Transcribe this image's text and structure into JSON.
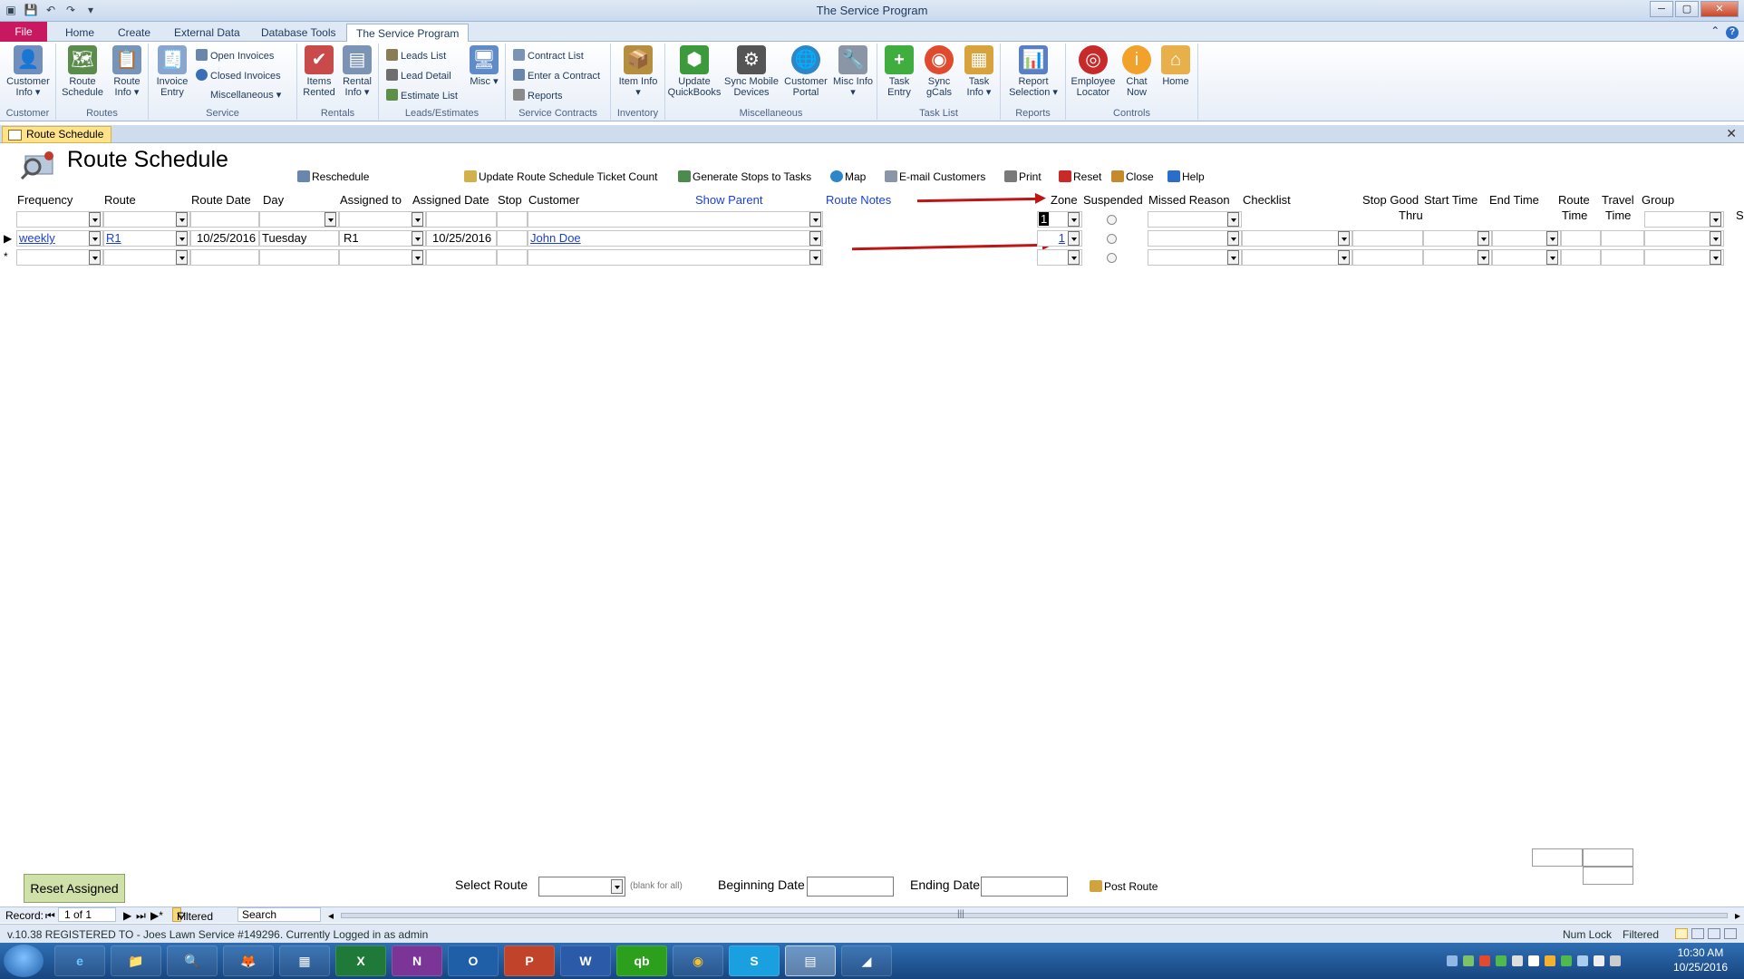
{
  "window": {
    "title": "The Service Program"
  },
  "tabs": [
    "File",
    "Home",
    "Create",
    "External Data",
    "Database Tools",
    "The Service Program"
  ],
  "ribbon": {
    "groups": {
      "customer": "Customer",
      "routes": "Routes",
      "service": "Service",
      "rentals": "Rentals",
      "leads": "Leads/Estimates",
      "contracts": "Service Contracts",
      "inventory": "Inventory",
      "misc": "Miscellaneous",
      "tasklist": "Task List",
      "reports": "Reports",
      "controls": "Controls"
    },
    "buttons": {
      "customer_info": "Customer Info ▾",
      "route_schedule": "Route Schedule",
      "route_info": "Route Info ▾",
      "invoice_entry": "Invoice Entry",
      "open_invoices": "Open Invoices",
      "closed_invoices": "Closed Invoices",
      "miscellaneous": "Miscellaneous ▾",
      "items_rented": "Items Rented",
      "rental_info": "Rental Info ▾",
      "leads_list": "Leads List",
      "lead_detail": "Lead Detail",
      "estimate_list": "Estimate List",
      "misc": "Misc ▾",
      "contract_list": "Contract List",
      "enter_contract": "Enter a Contract",
      "reports_small": "Reports",
      "item_info": "Item Info ▾",
      "update_quickbooks": "Update QuickBooks",
      "sync_mobile": "Sync Mobile Devices",
      "customer_portal": "Customer Portal",
      "misc_info": "Misc Info ▾",
      "task_entry": "Task Entry",
      "sync_gcals": "Sync gCals",
      "task_info": "Task Info ▾",
      "report_selection": "Report Selection ▾",
      "employee_locator": "Employee Locator",
      "chat_now": "Chat Now",
      "home": "Home"
    }
  },
  "doc_tab": "Route Schedule",
  "form": {
    "title": "Route Schedule",
    "toolbar": {
      "reschedule": "Reschedule",
      "update_count": "Update Route Schedule Ticket Count",
      "generate": "Generate Stops to Tasks",
      "map": "Map",
      "email": "E-mail Customers",
      "print": "Print",
      "reset": "Reset",
      "close": "Close",
      "help": "Help"
    },
    "headers": {
      "frequency": "Frequency",
      "route": "Route",
      "route_date": "Route Date",
      "day": "Day",
      "assigned_to": "Assigned to",
      "assigned_date": "Assigned Date",
      "stop": "Stop",
      "customer": "Customer",
      "show_parent": "Show Parent",
      "route_notes": "Route Notes",
      "zone": "Zone",
      "suspended": "Suspended",
      "missed_reason": "Missed Reason",
      "checklist": "Checklist",
      "stop_good_thru_1": "Stop Good",
      "stop_good_thru_2": "Thru",
      "start_time": "Start Time",
      "end_time": "End Time",
      "route_time_1": "Route",
      "route_time_2": "Time",
      "travel_time_1": "Travel",
      "travel_time_2": "Time",
      "group": "Group",
      "more": "S"
    },
    "filter_row": {
      "zone_value": "1"
    },
    "row": {
      "frequency": "weekly",
      "route": "R1",
      "route_date": "10/25/2016",
      "day": "Tuesday",
      "assigned_to": "R1",
      "assigned_date": "10/25/2016",
      "customer": "John Doe",
      "zone": "1"
    },
    "new_row_marker": "*"
  },
  "footer": {
    "reset_assigned": "Reset Assigned",
    "select_route": "Select Route",
    "blank_hint": "(blank for all)",
    "beginning_date": "Beginning Date",
    "ending_date": "Ending Date",
    "post_route": "Post Route"
  },
  "record_nav": {
    "label": "Record:",
    "position": "1 of 1",
    "filtered": "Filtered",
    "search": "Search"
  },
  "status": {
    "left": "v.10.38 REGISTERED TO - Joes Lawn Service #149296. Currently Logged in as admin",
    "num_lock": "Num Lock",
    "filtered": "Filtered"
  },
  "taskbar": {
    "apps": [
      "e",
      "📁",
      "🔍",
      "🦊",
      "▦",
      "X",
      "N",
      "O",
      "P",
      "W",
      "qb",
      "◉",
      "S",
      "▤",
      "◢"
    ],
    "time": "10:30 AM",
    "date": "10/25/2016"
  },
  "colors": {
    "accent_file_tab": "#c8185f",
    "link": "#1b3fd6",
    "arrow": "#c01515",
    "reset_button": "#cfe0a8"
  }
}
